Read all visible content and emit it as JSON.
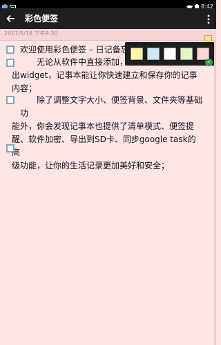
{
  "status_bar": {
    "time": "8:42"
  },
  "app_bar": {
    "title": "彩色便签"
  },
  "note": {
    "date": "2017/5/18 下午8:30",
    "items": [
      {
        "checked": false,
        "lines": [
          "欢迎使用彩色便签 – 日记备忘"
        ]
      },
      {
        "checked": false,
        "lines": [
          "　　无论从软件中直接添加，还是从桌面拖",
          "出widget，记事本能让你快速建立和保存你的记事",
          "内容；"
        ]
      },
      {
        "checked": false,
        "lines": [
          "　　除了调整文字大小、便签背景、文件夹等基础功",
          "能外，你会发现记事本也提供了清单模式、便签提",
          "醒、软件加密、导出到SD卡、同步google task的高",
          "级功能，让你的生活记录更加美好和安全；"
        ]
      },
      {
        "checked": false,
        "lines": [
          ""
        ]
      }
    ]
  },
  "palette": {
    "colors": [
      "#fff4a8",
      "#cfe7f5",
      "#ffffff",
      "#e6f5c6",
      "#ffd4d4"
    ],
    "selected_index": 4
  },
  "colors": {
    "background": "#ffe6e6",
    "app_bar": "#1f1f1f",
    "checkbox_border": "#8aa4b8"
  }
}
